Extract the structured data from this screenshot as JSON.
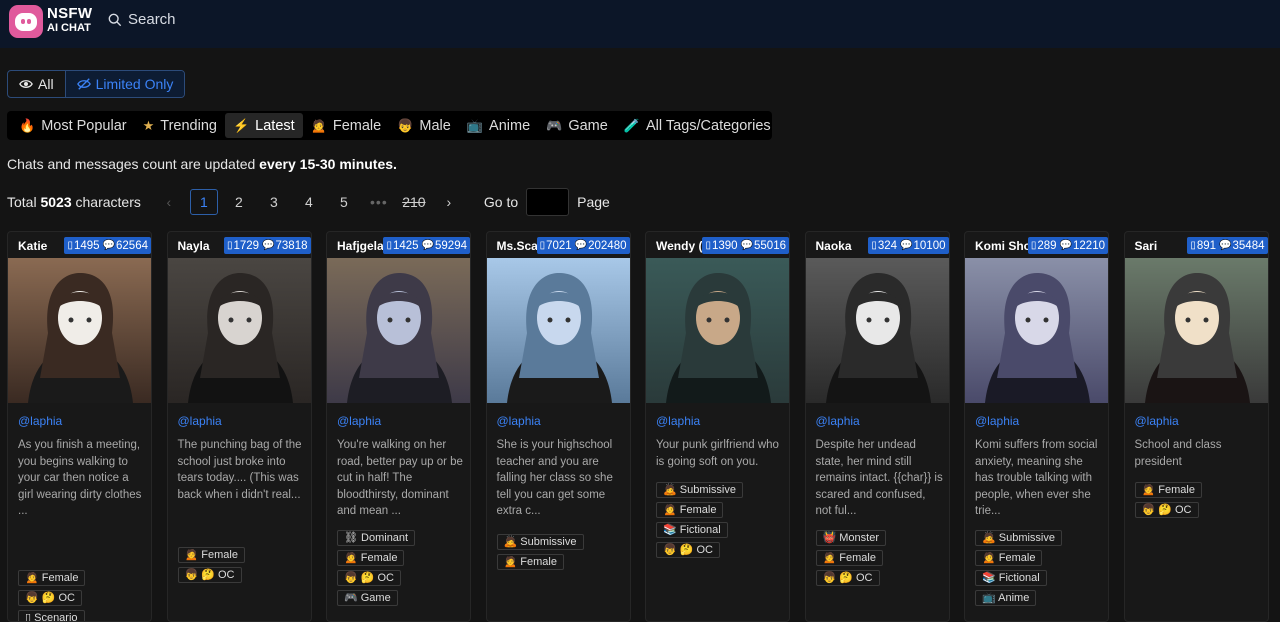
{
  "brand": {
    "line1": "NSFW",
    "line2": "AI CHAT"
  },
  "header": {
    "search_label": "Search"
  },
  "filter": {
    "all_label": "All",
    "limited_label": "Limited Only"
  },
  "tabs": [
    {
      "icon": "🔥",
      "label": "Most Popular"
    },
    {
      "icon": "★",
      "label": "Trending"
    },
    {
      "icon": "⚡",
      "label": "Latest"
    },
    {
      "icon": "🙍",
      "label": "Female"
    },
    {
      "icon": "👦",
      "label": "Male"
    },
    {
      "icon": "📺",
      "label": "Anime"
    },
    {
      "icon": "🎮",
      "label": "Game"
    },
    {
      "icon": "🧪",
      "label": "All Tags/Categories"
    }
  ],
  "notice": {
    "prefix": "Chats and messages count are updated ",
    "emphasis": "every 15-30 minutes."
  },
  "total": {
    "prefix": "Total ",
    "count": "5023",
    "suffix": " characters"
  },
  "pagination": {
    "prev": "‹",
    "pages": [
      "1",
      "2",
      "3",
      "4",
      "5"
    ],
    "ellipsis": "•••",
    "last": "210",
    "next": "›",
    "current": "1",
    "goto_label": "Go to",
    "page_label": "Page"
  },
  "cards": [
    {
      "name": "Katie",
      "chats": "1495",
      "messages": "62564",
      "author": "@laphia",
      "description": "As you finish a meeting, you begins walking to your car then notice a girl wearing dirty clothes ...",
      "tags": [
        "🙍 Female",
        "👦 🤔 OC",
        "▯ Scenario"
      ]
    },
    {
      "name": "Nayla",
      "chats": "1729",
      "messages": "73818",
      "author": "@laphia",
      "description": "The punching bag of the school just broke into tears today.... (This was back when i didn't real...",
      "tags": [
        "🙍 Female",
        "👦 🤔 OC"
      ]
    },
    {
      "name": "Hafjgela",
      "chats": "1425",
      "messages": "59294",
      "author": "@laphia",
      "description": "You're walking on her road, better pay up or be cut in half! The bloodthirsty, dominant and mean ...",
      "tags": [
        "⛓ Dominant",
        "🙍 Female",
        "👦 🤔 OC",
        "🎮 Game"
      ]
    },
    {
      "name": "Ms.Scarlett",
      "chats": "7021",
      "messages": "202480",
      "author": "@laphia",
      "description": "She is your highschool teacher and you are falling her class so she tell you can get some extra c...",
      "tags": [
        "🙇 Submissive",
        "🙍 Female"
      ]
    },
    {
      "name": "Wendy (Punk)",
      "chats": "1390",
      "messages": "55016",
      "author": "@laphia",
      "description": "Your punk girlfriend who is going soft on you.",
      "tags": [
        "🙇 Submissive",
        "🙍 Female",
        "📚 Fictional",
        "👦 🤔 OC"
      ]
    },
    {
      "name": "Naoka",
      "chats": "324",
      "messages": "10100",
      "author": "@laphia",
      "description": "Despite her undead state, her mind still remains intact. {{char}} is scared and confused, not ful...",
      "tags": [
        "👹 Monster",
        "🙍 Female",
        "👦 🤔 OC"
      ]
    },
    {
      "name": "Komi Shouko",
      "chats": "289",
      "messages": "12210",
      "author": "@laphia",
      "description": "Komi suffers from social anxiety, meaning she has trouble talking with people, when ever she trie...",
      "tags": [
        "🙇 Submissive",
        "🙍 Female",
        "📚 Fictional",
        "📺 Anime"
      ]
    },
    {
      "name": "Sari",
      "chats": "891",
      "messages": "35484",
      "author": "@laphia",
      "description": "School and class president",
      "tags": [
        "🙍 Female",
        "👦 🤔 OC"
      ]
    }
  ],
  "colors": {
    "accent": "#3b82f6",
    "stat_badge": "#1f5fc9",
    "header_bg": "#0c1628",
    "page_bg": "#141414"
  }
}
